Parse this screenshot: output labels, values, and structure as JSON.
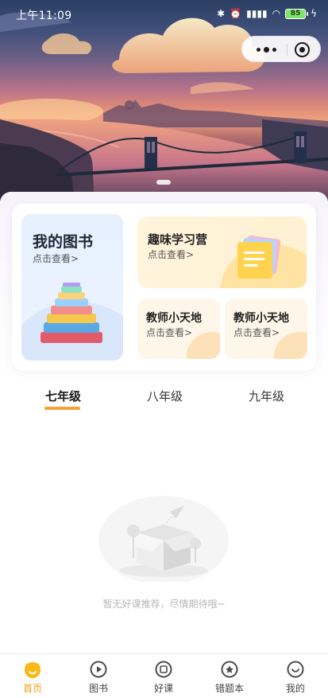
{
  "status_bar": {
    "time": "上午11:09",
    "battery": "85",
    "icons": [
      "bluetooth-icon",
      "alarm-icon",
      "signal-icon",
      "wifi-icon",
      "battery-icon",
      "charging-icon"
    ]
  },
  "capsule": {
    "more_icon": "more-icon",
    "close_icon": "close-icon"
  },
  "cards": {
    "my_books": {
      "title": "我的图书",
      "sub": "点击查看>"
    },
    "fun_camp": {
      "title": "趣味学习营",
      "sub": "点击查看>"
    },
    "teacher1": {
      "title": "教师小天地",
      "sub": "点击查看>"
    },
    "teacher2": {
      "title": "教师小天地",
      "sub": "点击查看>"
    }
  },
  "grade_tabs": [
    {
      "label": "七年级",
      "active": true
    },
    {
      "label": "八年级",
      "active": false
    },
    {
      "label": "九年级",
      "active": false
    }
  ],
  "empty_state": {
    "text": "暂无好课推荐，尽情期待哦~"
  },
  "bottom_nav": [
    {
      "label": "首页",
      "icon": "home-icon",
      "active": true
    },
    {
      "label": "图书",
      "icon": "book-icon",
      "active": false
    },
    {
      "label": "好课",
      "icon": "course-icon",
      "active": false
    },
    {
      "label": "错题本",
      "icon": "wrong-questions-icon",
      "active": false
    },
    {
      "label": "我的",
      "icon": "profile-icon",
      "active": false
    }
  ],
  "colors": {
    "accent": "#f4a236",
    "nav_active": "#f0a215",
    "my_books_bg": "#e6f0ff",
    "fun_camp_bg": "#fff4dc",
    "teacher_bg": "#fff6ea"
  }
}
